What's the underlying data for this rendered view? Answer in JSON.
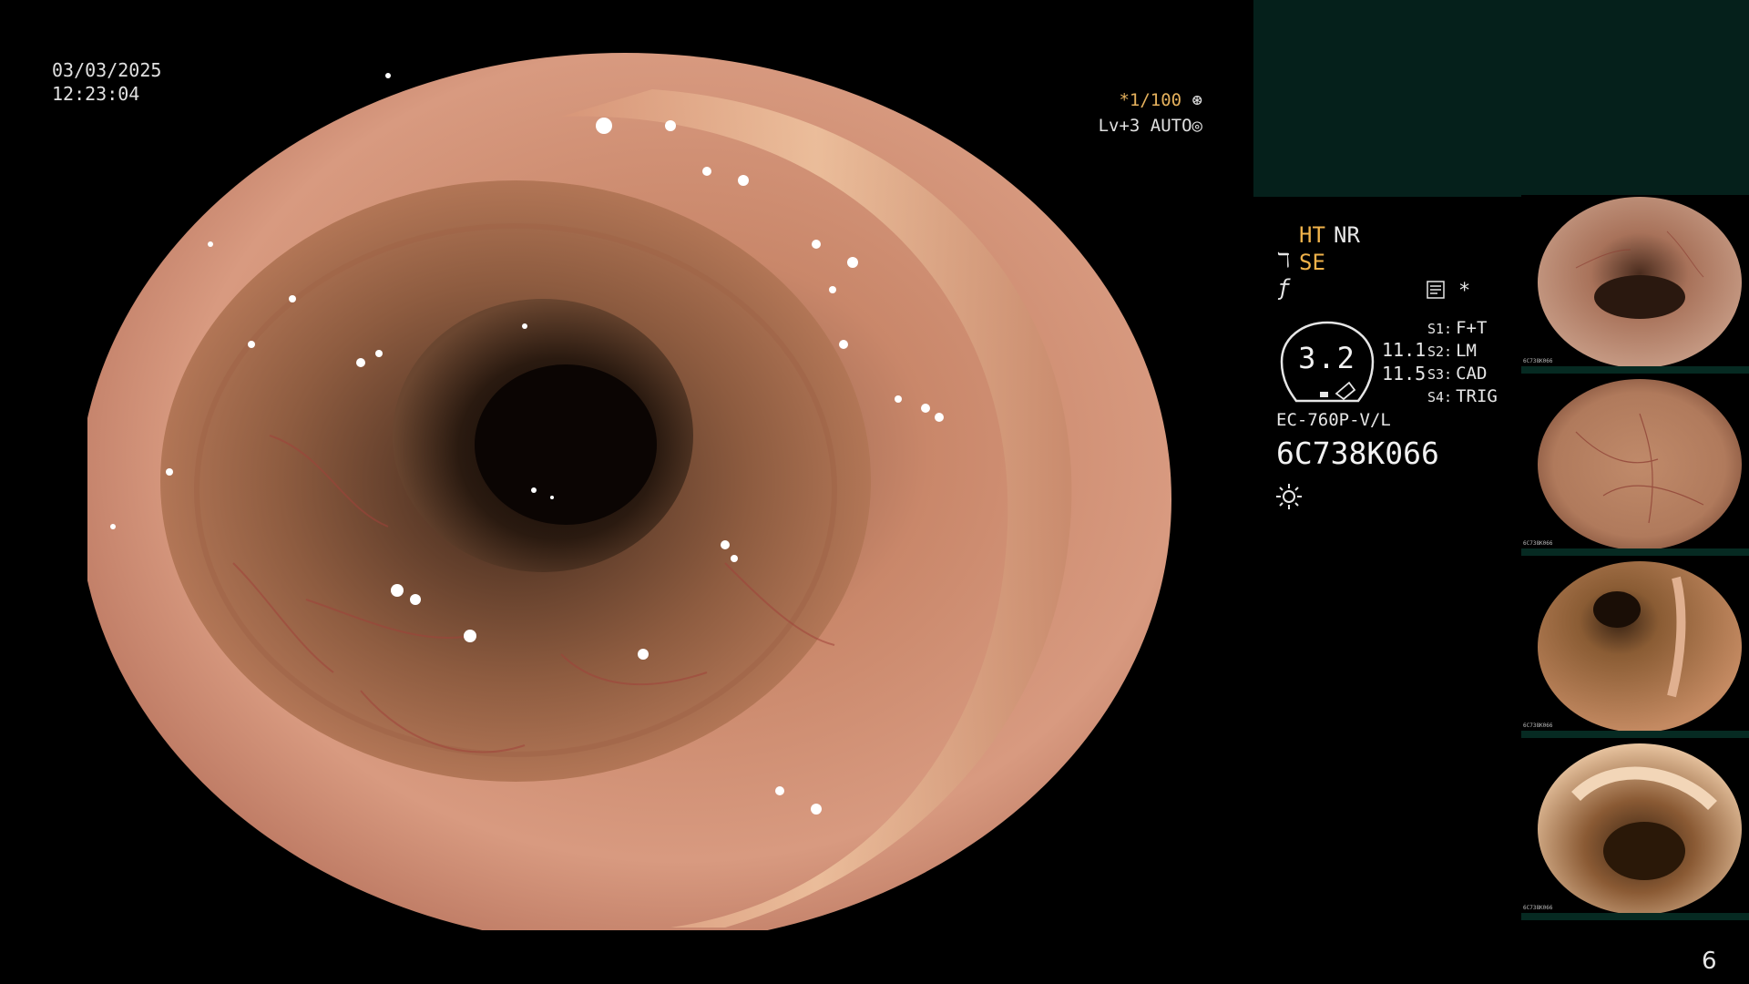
{
  "overlay": {
    "date": "03/03/2025",
    "time": "12:23:04",
    "shutter": "*1/100",
    "iris": "Lv+3 AUTO"
  },
  "panel": {
    "mode_ht": "HT",
    "mode_nr": "NR",
    "mode_se": "SE",
    "star": "*",
    "gauge_value": "3.2",
    "val1": "11.1",
    "val2": "11.5",
    "switches": [
      {
        "key": "S1:",
        "value": "F+T"
      },
      {
        "key": "S2:",
        "value": "LM"
      },
      {
        "key": "S3:",
        "value": "CAD"
      },
      {
        "key": "S4:",
        "value": "TRIG"
      }
    ],
    "scope_model": "EC-760P-V/L",
    "scope_serial": "6C738K066"
  },
  "thumbnails": [
    {
      "id": "6C738K066"
    },
    {
      "id": "6C738K066"
    },
    {
      "id": "6C738K066"
    },
    {
      "id": "6C738K066"
    }
  ],
  "page_number": "6",
  "colors": {
    "accent_orange": "#f0b24a",
    "panel_green": "#05201b",
    "text": "#e6e6e6"
  }
}
